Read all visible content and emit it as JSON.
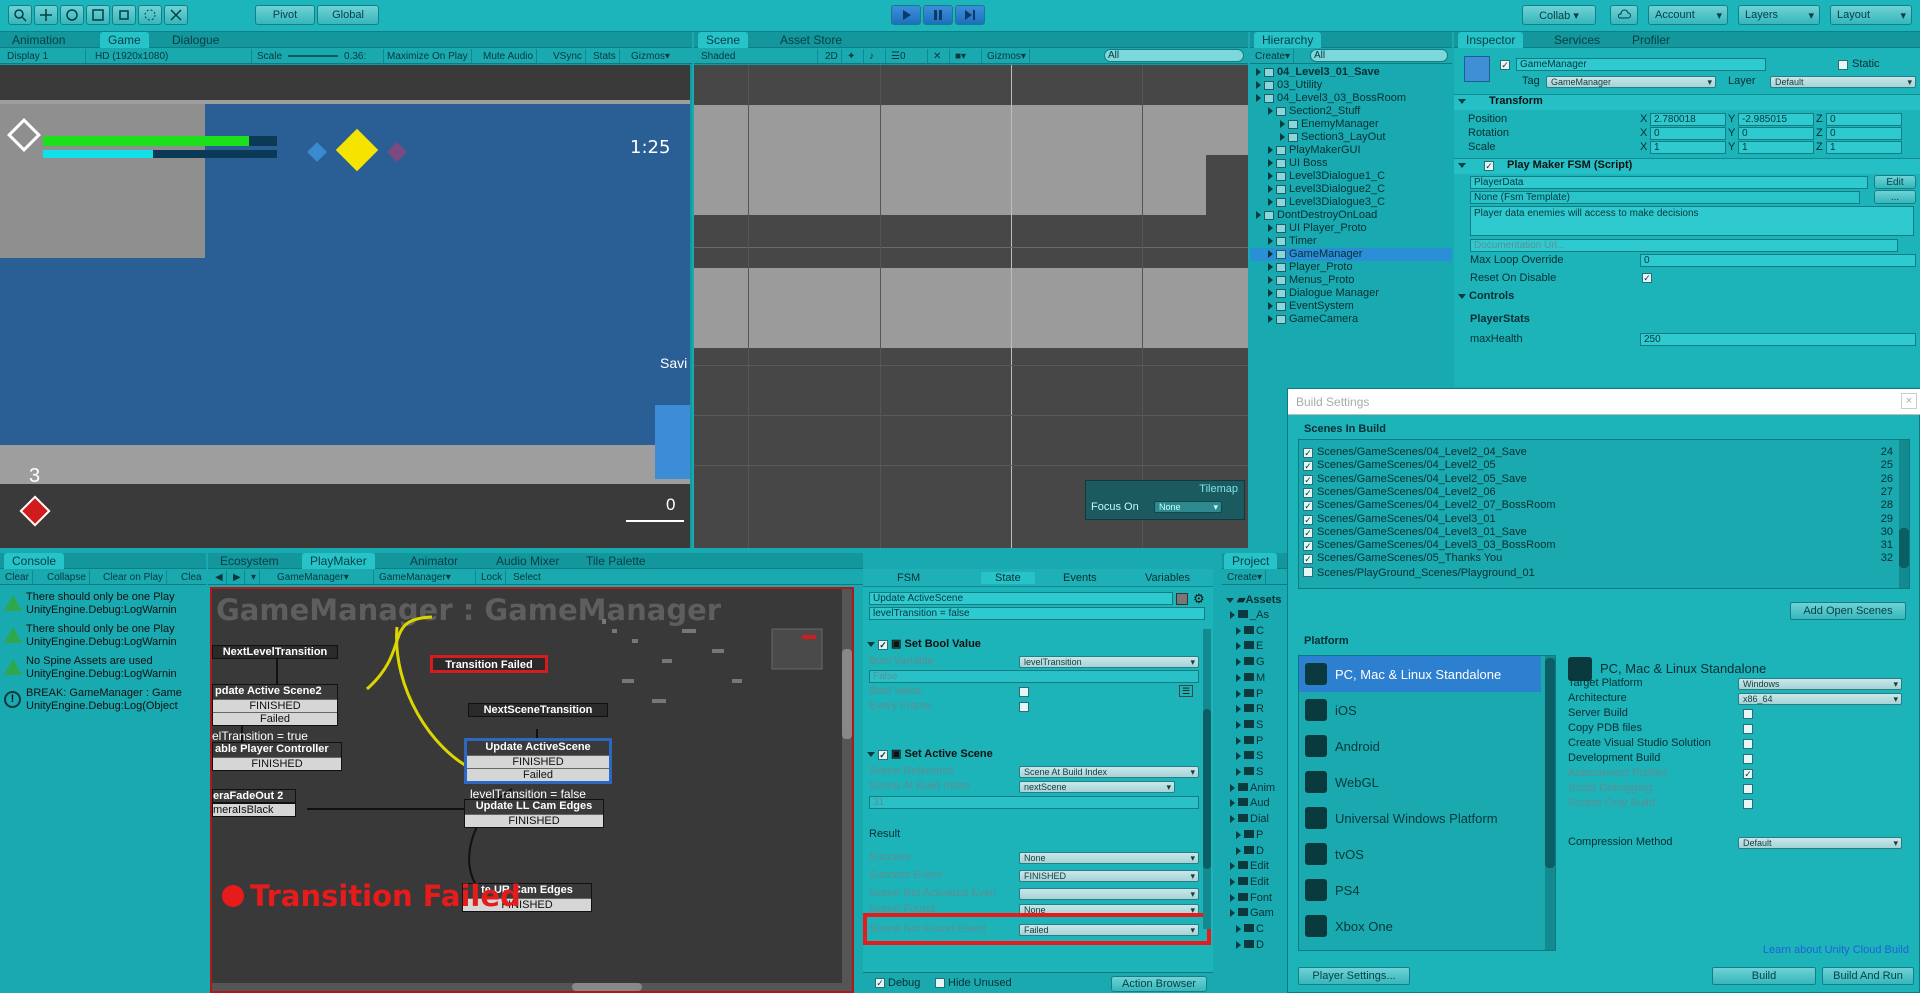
{
  "toolbar": {
    "pivot": "Pivot",
    "global": "Global",
    "collab": "Collab ▾",
    "account": "Account",
    "layers": "Layers",
    "layout": "Layout"
  },
  "game": {
    "tabs": [
      "Animation",
      "Game",
      "Dialogue"
    ],
    "display": "Display 1",
    "resolution": "HD (1920x1080)",
    "scale_label": "Scale",
    "scale_value": "0.36:",
    "maximize": "Maximize On Play",
    "mute": "Mute Audio",
    "vsync": "VSync",
    "stats": "Stats",
    "gizmos": "Gizmos",
    "timer": "1:25",
    "lives": "3",
    "counter": "0",
    "save_text": "Savi",
    "health_fraction": 0.88,
    "energy_fraction": 0.47
  },
  "scene": {
    "tabs": [
      "Scene",
      "Asset Store"
    ],
    "shading": "Shaded",
    "mode2d": "2D",
    "gizmos": "Gizmos",
    "search_placeholder": "All",
    "layer_count": "0",
    "tilemap_title": "Tilemap",
    "focus_on": "Focus On",
    "focus_value": "None"
  },
  "hierarchy": {
    "tab": "Hierarchy",
    "create": "Create",
    "search_placeholder": "All",
    "items": [
      {
        "label": "04_Level3_01_Save",
        "indent": 0,
        "bold": true
      },
      {
        "label": "03_Utility",
        "indent": 0,
        "bold": false
      },
      {
        "label": "04_Level3_03_BossRoom",
        "indent": 0,
        "bold": false
      },
      {
        "label": "Section2_Stuff",
        "indent": 1,
        "bold": false
      },
      {
        "label": "EnemyManager",
        "indent": 2,
        "bold": false
      },
      {
        "label": "Section3_LayOut",
        "indent": 2,
        "bold": false
      },
      {
        "label": "PlayMakerGUI",
        "indent": 1,
        "bold": false
      },
      {
        "label": "UI Boss",
        "indent": 1,
        "bold": false
      },
      {
        "label": "Level3Dialogue1_C",
        "indent": 1,
        "bold": false
      },
      {
        "label": "Level3Dialogue2_C",
        "indent": 1,
        "bold": false
      },
      {
        "label": "Level3Dialogue3_C",
        "indent": 1,
        "bold": false
      },
      {
        "label": "DontDestroyOnLoad",
        "indent": 0,
        "bold": false
      },
      {
        "label": "UI Player_Proto",
        "indent": 1,
        "bold": false
      },
      {
        "label": "Timer",
        "indent": 1,
        "bold": false
      },
      {
        "label": "GameManager",
        "indent": 1,
        "bold": false,
        "selected": true
      },
      {
        "label": "Player_Proto",
        "indent": 1,
        "bold": false
      },
      {
        "label": "Menus_Proto",
        "indent": 1,
        "bold": false
      },
      {
        "label": "Dialogue Manager",
        "indent": 1,
        "bold": false
      },
      {
        "label": "EventSystem",
        "indent": 1,
        "bold": false
      },
      {
        "label": "GameCamera",
        "indent": 1,
        "bold": false
      }
    ]
  },
  "inspector": {
    "tabs": [
      "Inspector",
      "Services",
      "Profiler"
    ],
    "object_name": "GameManager",
    "static_label": "Static",
    "tag_label": "Tag",
    "tag_value": "GameManager",
    "layer_label": "Layer",
    "layer_value": "Default",
    "transform_title": "Transform",
    "position_label": "Position",
    "rotation_label": "Rotation",
    "scale_label": "Scale",
    "pos": [
      "2.780018",
      "-2.985015",
      "0"
    ],
    "rot": [
      "0",
      "0",
      "0"
    ],
    "scl": [
      "1",
      "1",
      "1"
    ],
    "fsm_title": "Play Maker FSM (Script)",
    "fsm_name": "PlayerData",
    "edit": "Edit",
    "template": "None (Fsm Template)",
    "description": "Player data enemies will access to make decisions",
    "doc_url": "Documentation Url...",
    "max_loop": "Max Loop Override",
    "max_loop_value": "0",
    "reset": "Reset On Disable",
    "controls": "Controls",
    "player_stats": "PlayerStats",
    "max_health": "maxHealth",
    "max_health_value": "250"
  },
  "build": {
    "title": "Build Settings",
    "scenes_header": "Scenes In Build",
    "scenes": [
      {
        "path": "Scenes/GameScenes/04_Level2_04_Save",
        "index": "24",
        "checked": true
      },
      {
        "path": "Scenes/GameScenes/04_Level2_05",
        "index": "25",
        "checked": true
      },
      {
        "path": "Scenes/GameScenes/04_Level2_05_Save",
        "index": "26",
        "checked": true
      },
      {
        "path": "Scenes/GameScenes/04_Level2_06",
        "index": "27",
        "checked": true
      },
      {
        "path": "Scenes/GameScenes/04_Level2_07_BossRoom",
        "index": "28",
        "checked": true
      },
      {
        "path": "Scenes/GameScenes/04_Level3_01",
        "index": "29",
        "checked": true
      },
      {
        "path": "Scenes/GameScenes/04_Level3_01_Save",
        "index": "30",
        "checked": true
      },
      {
        "path": "Scenes/GameScenes/04_Level3_03_BossRoom",
        "index": "31",
        "checked": true
      },
      {
        "path": "Scenes/GameScenes/05_Thanks You",
        "index": "32",
        "checked": true
      },
      {
        "path": "Scenes/PlayGround_Scenes/Playground_01",
        "index": "",
        "checked": false
      }
    ],
    "add_open": "Add Open Scenes",
    "platform_header": "Platform",
    "platforms": [
      "PC, Mac & Linux Standalone",
      "iOS",
      "Android",
      "WebGL",
      "Universal Windows Platform",
      "tvOS",
      "PS4",
      "Xbox One"
    ],
    "selected_title": "PC, Mac & Linux Standalone",
    "target_platform": "Target Platform",
    "target_value": "Windows",
    "architecture": "Architecture",
    "architecture_value": "x86_64",
    "server_build": "Server Build",
    "copy_pdb": "Copy PDB files",
    "vs_solution": "Create Visual Studio Solution",
    "dev_build": "Development Build",
    "autoconnect": "Autoconnect Profiler",
    "script_debug": "Script Debugging",
    "scripts_only": "Scripts Only Build",
    "compression": "Compression Method",
    "compression_value": "Default",
    "cloud_link": "Learn about Unity Cloud Build",
    "player_settings": "Player Settings...",
    "build_btn": "Build",
    "build_run": "Build And Run"
  },
  "console": {
    "tab": "Console",
    "clear": "Clear",
    "collapse": "Collapse",
    "clear_on_play": "Clear on Play",
    "clear_on_build": "Clea",
    "messages": [
      {
        "line1": "There should only be one Play",
        "line2": "UnityEngine.Debug:LogWarnin",
        "type": "warn"
      },
      {
        "line1": "There should only be one Play",
        "line2": "UnityEngine.Debug:LogWarnin",
        "type": "warn"
      },
      {
        "line1": "No Spine Assets are used",
        "line2": "UnityEngine.Debug:LogWarnin",
        "type": "warn"
      },
      {
        "line1": "BREAK: GameManager : Game",
        "line2": "UnityEngine.Debug:Log(Object",
        "type": "info"
      }
    ]
  },
  "playmaker": {
    "tabs": [
      "Ecosystem",
      "PlayMaker",
      "Animator",
      "Audio Mixer",
      "Tile Palette"
    ],
    "go_select": "GameManager",
    "fsm_select": "GameManager",
    "lock": "Lock",
    "select": "Select",
    "graph_title": "GameManager : GameManager",
    "status": "Transition Failed",
    "nodes": {
      "next_level": "NextLevelTransition",
      "transition_failed": "Transition Failed",
      "uas2": "pdate Active Scene2",
      "uas2_finished": "FINISHED",
      "uas2_failed": "Failed",
      "lvl_true": "elTransition = true",
      "enable_pc": "able Player Controller",
      "enable_pc_finished": "FINISHED",
      "fade_out": "eraFadeOut 2",
      "cam_black": "meraIsBlack",
      "next_scene": "NextSceneTransition",
      "uas": "Update ActiveScene",
      "uas_finished": "FINISHED",
      "uas_failed": "Failed",
      "lvl_false": "levelTransition = false",
      "ll_cam": "Update LL Cam Edges",
      "ll_finished": "FINISHED",
      "ur_cam": "te UR Cam Edges",
      "ur_finished": "FINISHED"
    }
  },
  "state": {
    "tabs": [
      "FSM",
      "State",
      "Events",
      "Variables"
    ],
    "name": "Update ActiveScene",
    "desc": "levelTransition = false",
    "action1": "Set Bool Value",
    "bool_var": "Bool Variable",
    "bool_var_value": "levelTransition",
    "false_text": "False",
    "bool_value": "Bool Value",
    "every_frame": "Every Frame",
    "action2": "Set Active Scene",
    "scene_ref": "Scene Reference",
    "scene_ref_value": "Scene At Build Index",
    "scene_index": "Scene At Build Index",
    "scene_index_value": "nextScene",
    "num": "31",
    "result": "Result",
    "success": "Success",
    "success_value": "None",
    "success_event": "Success Event",
    "success_event_value": "FINISHED",
    "not_activated": "Scene Not Activated Even",
    "scene_found": "Scene Found",
    "scene_found_value": "None",
    "not_found": "Scene Not Found Event",
    "not_found_value": "Failed",
    "debug": "Debug",
    "hide_unused": "Hide Unused",
    "action_browser": "Action Browser"
  },
  "project": {
    "tab": "Project",
    "create": "Create",
    "assets": "Assets",
    "items": [
      "_As",
      "C",
      "E",
      "G",
      "M",
      "P",
      "R",
      "S",
      "P",
      "S",
      "S",
      "Anim",
      "Aud",
      "Dial",
      "P",
      "D",
      "Edit",
      "Edit",
      "Font",
      "Gam",
      "C",
      "D"
    ]
  }
}
